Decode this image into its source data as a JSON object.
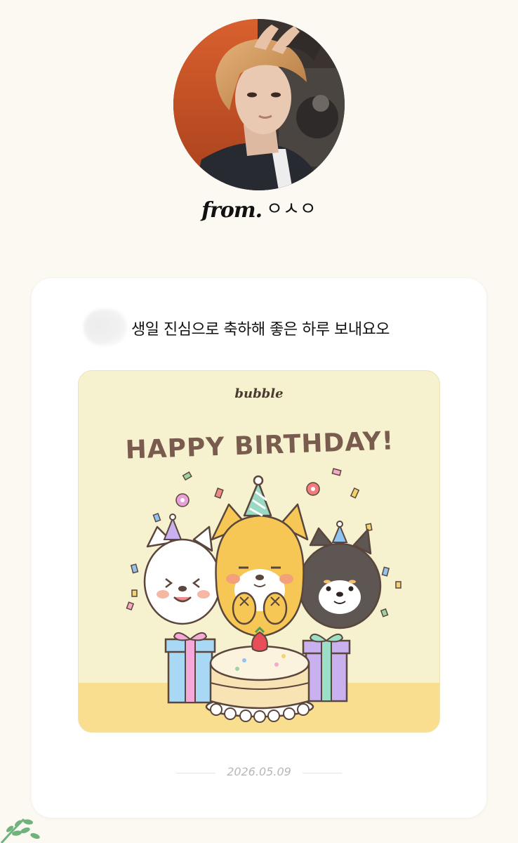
{
  "profile": {
    "from_label": "from.",
    "from_name": "ㅇㅅㅇ"
  },
  "message": {
    "text": "생일 진심으로 축하해 좋은 하루 보내요오"
  },
  "sticker": {
    "brand": "bubble",
    "title": "HAPPY BIRTHDAY!"
  },
  "footer": {
    "date": "2026.05.09"
  },
  "colors": {
    "page_background": "#FCF8F2",
    "card_background": "#FFFFFF",
    "sticker_background": "#F6F1CF",
    "title_brown": "#7A5C4E",
    "date_grey": "#B7B7B7",
    "leaf_green": "#6FB27C"
  },
  "icons": [
    "profile-photo",
    "blurred-sender-avatar",
    "birthday-sticker-illustration",
    "leaf-sprig-icon"
  ]
}
